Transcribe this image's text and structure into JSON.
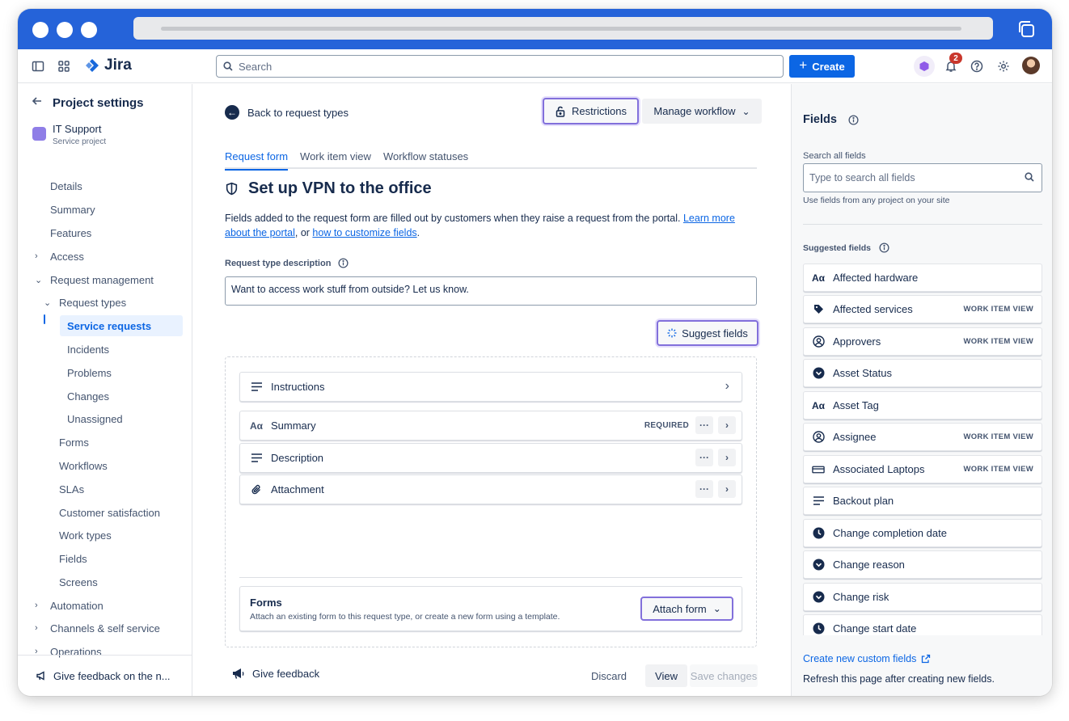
{
  "topnav": {
    "app_name": "Jira",
    "search_placeholder": "Search",
    "create_label": "Create",
    "notifications_count": "2"
  },
  "sidebar": {
    "header": "Project settings",
    "project_name": "IT Support",
    "project_type": "Service project",
    "items": [
      {
        "label": "Details"
      },
      {
        "label": "Summary"
      },
      {
        "label": "Features"
      },
      {
        "label": "Access"
      },
      {
        "label": "Request management"
      },
      {
        "label": "Request types"
      },
      {
        "label": "Service requests"
      },
      {
        "label": "Incidents"
      },
      {
        "label": "Problems"
      },
      {
        "label": "Changes"
      },
      {
        "label": "Unassigned"
      },
      {
        "label": "Forms"
      },
      {
        "label": "Workflows"
      },
      {
        "label": "SLAs"
      },
      {
        "label": "Customer satisfaction"
      },
      {
        "label": "Work types"
      },
      {
        "label": "Fields"
      },
      {
        "label": "Screens"
      },
      {
        "label": "Automation"
      },
      {
        "label": "Channels & self service"
      },
      {
        "label": "Operations"
      }
    ],
    "footer": "Give feedback on the n..."
  },
  "main": {
    "back_label": "Back to request types",
    "restrictions_label": "Restrictions",
    "manage_workflow_label": "Manage workflow",
    "tabs": [
      {
        "label": "Request form"
      },
      {
        "label": "Work item view"
      },
      {
        "label": "Workflow statuses"
      }
    ],
    "title": "Set up VPN to the office",
    "description_pre": "Fields added to the request form are filled out by customers when they raise a request from the portal. ",
    "description_link1": "Learn more about the portal",
    "description_mid": ", or ",
    "description_link2": "how to customize fields",
    "description_post": ".",
    "rtd_label": "Request type description",
    "rtd_value": "Want to access work stuff from outside? Let us know.",
    "suggest_label": "Suggest fields",
    "fields": [
      {
        "label": "Instructions"
      },
      {
        "label": "Summary",
        "lozenge": "REQUIRED"
      },
      {
        "label": "Description"
      },
      {
        "label": "Attachment"
      }
    ],
    "forms_title": "Forms",
    "forms_sub": "Attach an existing form to this request type, or create a new form using a template.",
    "attach_label": "Attach form",
    "give_feedback": "Give feedback",
    "discard": "Discard",
    "view": "View",
    "save": "Save changes"
  },
  "rpanel": {
    "title": "Fields",
    "search_label": "Search all fields",
    "search_placeholder": "Type to search all fields",
    "hint": "Use fields from any project on your site",
    "suggested_label": "Suggested fields",
    "items": [
      {
        "label": "Affected hardware",
        "icon": "text-icon",
        "lozenge": ""
      },
      {
        "label": "Affected services",
        "icon": "tag-icon",
        "lozenge": "WORK ITEM VIEW"
      },
      {
        "label": "Approvers",
        "icon": "person-icon",
        "lozenge": "WORK ITEM VIEW"
      },
      {
        "label": "Asset Status",
        "icon": "dropdown-icon",
        "lozenge": ""
      },
      {
        "label": "Asset Tag",
        "icon": "text-icon",
        "lozenge": ""
      },
      {
        "label": "Assignee",
        "icon": "person-icon",
        "lozenge": "WORK ITEM VIEW"
      },
      {
        "label": "Associated Laptops",
        "icon": "laptop-icon",
        "lozenge": "WORK ITEM VIEW"
      },
      {
        "label": "Backout plan",
        "icon": "paragraph-icon",
        "lozenge": ""
      },
      {
        "label": "Change completion date",
        "icon": "clock-icon",
        "lozenge": ""
      },
      {
        "label": "Change reason",
        "icon": "dropdown-icon",
        "lozenge": ""
      },
      {
        "label": "Change risk",
        "icon": "dropdown-icon",
        "lozenge": ""
      },
      {
        "label": "Change start date",
        "icon": "clock-icon",
        "lozenge": ""
      }
    ],
    "create_link": "Create new custom fields",
    "refresh": "Refresh this page after creating new fields."
  }
}
